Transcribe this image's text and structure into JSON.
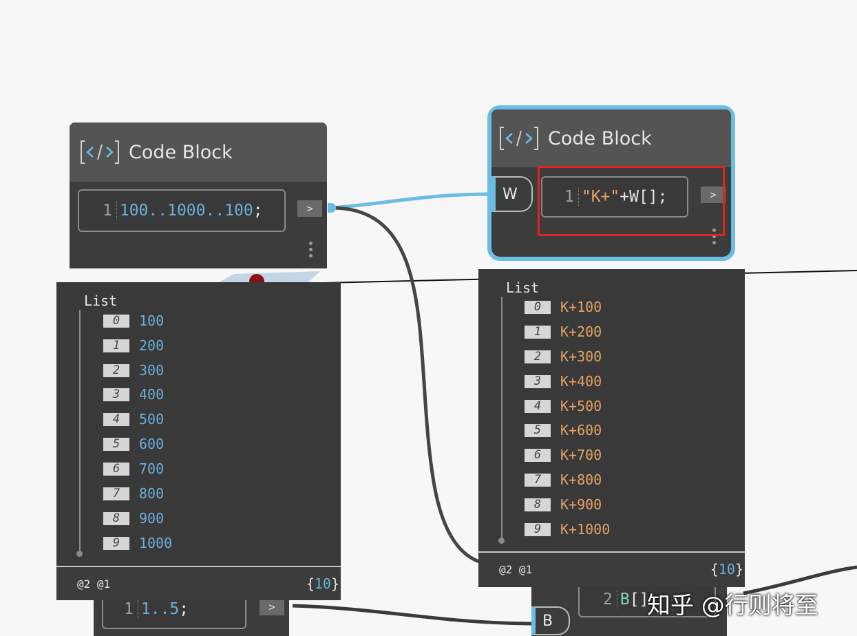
{
  "node_left": {
    "title": "Code Block",
    "code": {
      "line": "1",
      "start": "100",
      "sep1": "..",
      "end": "1000",
      "sep2": "..",
      "step": "100",
      "semi": ";"
    },
    "output_label": ">"
  },
  "node_right": {
    "title": "Code Block",
    "input_port": "W",
    "code": {
      "line": "1",
      "literal": "\"K+\"",
      "rest": "+W[];"
    },
    "output_label": ">"
  },
  "preview_left": {
    "title": "List",
    "items": [
      {
        "i": "0",
        "v": "100"
      },
      {
        "i": "1",
        "v": "200"
      },
      {
        "i": "2",
        "v": "300"
      },
      {
        "i": "3",
        "v": "400"
      },
      {
        "i": "4",
        "v": "500"
      },
      {
        "i": "5",
        "v": "600"
      },
      {
        "i": "6",
        "v": "700"
      },
      {
        "i": "7",
        "v": "800"
      },
      {
        "i": "8",
        "v": "900"
      },
      {
        "i": "9",
        "v": "1000"
      }
    ],
    "levels": "@2 @1",
    "count_open": "{",
    "count": "10",
    "count_close": "}"
  },
  "preview_right": {
    "title": "List",
    "items": [
      {
        "i": "0",
        "v": "K+100"
      },
      {
        "i": "1",
        "v": "K+200"
      },
      {
        "i": "2",
        "v": "K+300"
      },
      {
        "i": "3",
        "v": "K+400"
      },
      {
        "i": "4",
        "v": "K+500"
      },
      {
        "i": "5",
        "v": "K+600"
      },
      {
        "i": "6",
        "v": "K+700"
      },
      {
        "i": "7",
        "v": "K+800"
      },
      {
        "i": "8",
        "v": "K+900"
      },
      {
        "i": "9",
        "v": "K+1000"
      }
    ],
    "levels": "@2 @1",
    "count_open": "{",
    "count": "10",
    "count_close": "}"
  },
  "node_bottom_left": {
    "code": {
      "line": "1",
      "start": "1",
      "sep": "..",
      "end": "5",
      "semi": ";"
    },
    "output_label": ">"
  },
  "node_bottom_right": {
    "input_port": "B",
    "code": {
      "line": "2",
      "var": "B",
      "rest": "[]"
    }
  },
  "watermark": "知乎 @行则将至",
  "colors": {
    "accent": "#6cbde2",
    "number": "#6ab0dc",
    "string": "#e6a264",
    "highlight": "#e02424"
  }
}
